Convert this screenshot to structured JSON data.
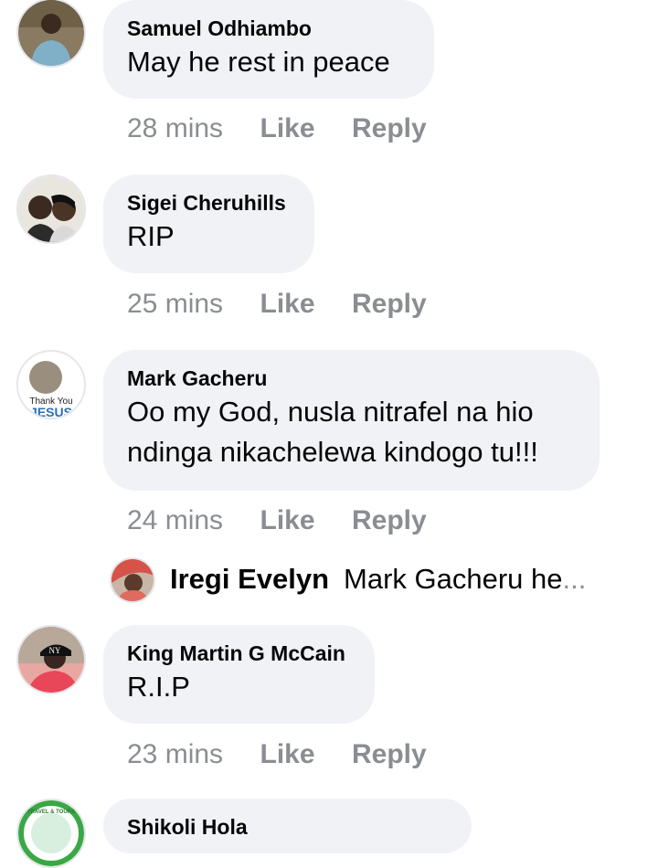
{
  "comments": [
    {
      "name": "Samuel Odhiambo",
      "text": "May he rest in peace",
      "time": "28 mins",
      "like": "Like",
      "reply": "Reply"
    },
    {
      "name": "Sigei Cheruhills",
      "text": "RIP",
      "time": "25 mins",
      "like": "Like",
      "reply": "Reply"
    },
    {
      "name": "Mark Gacheru",
      "text_line1": "Oo my God, nusla nitrafel na hio",
      "text_line2": "ndinga nikachelewa kindogo tu!!!",
      "time": "24 mins",
      "like": "Like",
      "reply": "Reply"
    },
    {
      "name": "King Martin G McCain",
      "text": "R.I.P",
      "time": "23 mins",
      "like": "Like",
      "reply": "Reply"
    },
    {
      "name": "Shikoli Hola",
      "avatar_text": "TRAVEL & TOURS"
    }
  ],
  "reply_preview": {
    "name": "Iregi Evelyn",
    "text": "Mark Gacheru he",
    "ellipsis": "..."
  },
  "avatar_texts": {
    "thank_you": "Thank You",
    "jesus": "JESUS"
  },
  "colors": {
    "bubble": "#f0f2f5",
    "meta": "#8a8d91",
    "text": "#050505"
  }
}
